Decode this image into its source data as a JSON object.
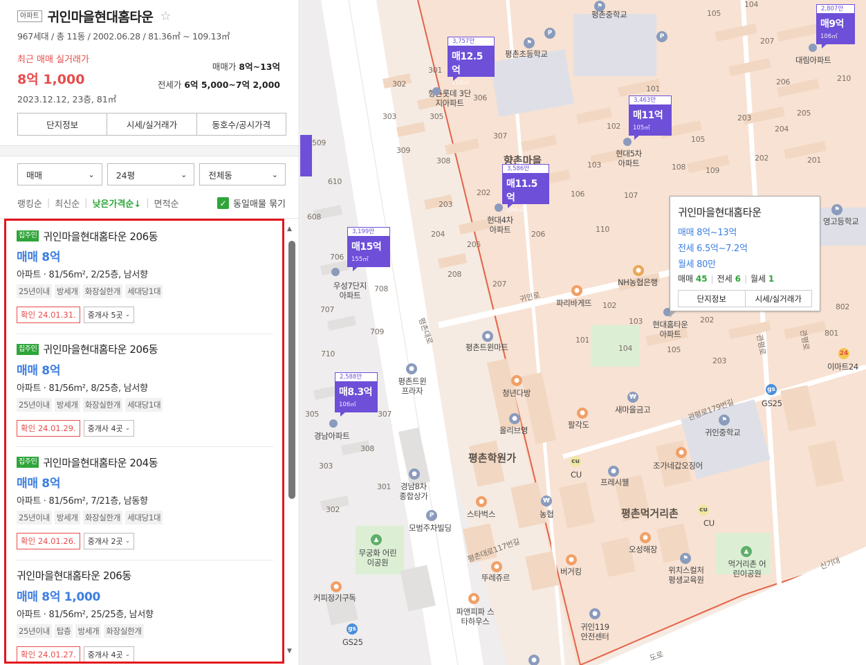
{
  "panel": {
    "type_badge": "아파트",
    "name": "귀인마을현대홈타운",
    "star": "☆",
    "summary": "967세대 / 총 11동 / 2002.06.28 / 81.36㎡ ~ 109.13㎡",
    "recent_label": "최근 매매 실거래가",
    "recent_price": "8억 1,000",
    "recent_meta": "2023.12.12, 23층, 81㎡",
    "sale_range_label": "매매가",
    "sale_range_value": "8억~13억",
    "jeonse_range_label": "전세가",
    "jeonse_range_value": "6억 5,000~7억 2,000",
    "tabs": [
      "단지정보",
      "시세/실거래가",
      "동호수/공시가격"
    ],
    "filters": [
      "매매",
      "24평",
      "전체동"
    ],
    "sort": [
      "랭킹순",
      "최신순",
      "낮은가격순↓",
      "면적순"
    ],
    "bundle_label": "동일매물 묶기",
    "listings": [
      {
        "owner": "집주인",
        "title": "귀인마을현대홈타운 206동",
        "price": "매매 8억",
        "spec": "아파트 · 81/56m², 2/25층, 남서향",
        "tags": [
          "25년이내",
          "방세개",
          "화장실한개",
          "세대당1대"
        ],
        "confirm": "확인 24.01.31.",
        "agents": "중개사 5곳"
      },
      {
        "owner": "집주인",
        "title": "귀인마을현대홈타운 206동",
        "price": "매매 8억",
        "spec": "아파트 · 81/56m², 8/25층, 남서향",
        "tags": [
          "25년이내",
          "방세개",
          "화장실한개",
          "세대당1대"
        ],
        "confirm": "확인 24.01.29.",
        "agents": "중개사 4곳"
      },
      {
        "owner": "집주인",
        "title": "귀인마을현대홈타운 204동",
        "price": "매매 8억",
        "spec": "아파트 · 81/56m², 7/21층, 남동향",
        "tags": [
          "25년이내",
          "방세개",
          "화장실한개",
          "세대당1대"
        ],
        "confirm": "확인 24.01.26.",
        "agents": "중개사 2곳"
      },
      {
        "owner": "",
        "title": "귀인마을현대홈타운 206동",
        "price": "매매 8억 1,000",
        "spec": "아파트 · 81/56m², 25/25층, 남서향",
        "tags": [
          "25년이내",
          "탑층",
          "방세개",
          "화장실한개"
        ],
        "confirm": "확인 24.01.27.",
        "agents": "중개사 4곳"
      }
    ]
  },
  "map": {
    "markers": [
      {
        "count": "3,757만",
        "price": "매12.5억",
        "area": "110㎡"
      },
      {
        "count": "3,463만",
        "price": "매11억",
        "area": "105㎡"
      },
      {
        "count": "3,586만",
        "price": "매11.5억",
        "area": "106㎡"
      },
      {
        "count": "3,199만",
        "price": "매15억",
        "area": "155㎡"
      },
      {
        "count": "2,588만",
        "price": "매8.3억",
        "area": "106㎡"
      },
      {
        "count": "2,807만",
        "price": "매9억",
        "area": "106㎡"
      }
    ],
    "popup": {
      "title": "귀인마을현대홈타운",
      "sale": "매매 8억~13억",
      "jeonse": "전세 6.5억~7.2억",
      "monthly": "월세 80만",
      "c_sale_label": "매매",
      "c_sale": "45",
      "c_jeonse_label": "전세",
      "c_jeonse": "6",
      "c_month_label": "월세",
      "c_month": "1",
      "btn1": "단지정보",
      "btn2": "시세/실거래가"
    },
    "places": [
      "평촌중학교",
      "평촌초등학교",
      "대림아파트",
      "향촌롯데 3단지아파트",
      "현대5차 아파트",
      "향촌마을",
      "현대4차 아파트",
      "영고등학교",
      "NH농협은행",
      "파리바게뜨",
      "귀인로",
      "현대홈타운 아파트",
      "우성7단지 아파트",
      "평촌트윈마트",
      "관평로",
      "이마트24",
      "GS25",
      "평촌트윈 프라자",
      "청년다방",
      "경남아파트",
      "올리브영",
      "새마을금고",
      "관평로179번길",
      "귀인중학교",
      "팔각도",
      "평촌학원가",
      "CU",
      "조가네갑오징어",
      "프레시웰",
      "경남8차 종합상가",
      "모범주차빌딩",
      "스타벅스",
      "농협",
      "평촌먹거리촌",
      "오성해장",
      "무궁화 어린이공원",
      "평촌대로117번길",
      "뚜레쥬르",
      "버거킹",
      "위치스컬처 평생교육원",
      "먹거리촌 어린이공원",
      "커피정기구독",
      "파앤피파 스타하우스",
      "귀인119 안전센터",
      "신기대",
      "평촌대로",
      "관평로",
      "도로"
    ]
  },
  "colors": {
    "accent_purple": "#6d4fd8",
    "green": "#2fa53a",
    "red": "#e84b4b",
    "blue": "#3c7ee1"
  }
}
